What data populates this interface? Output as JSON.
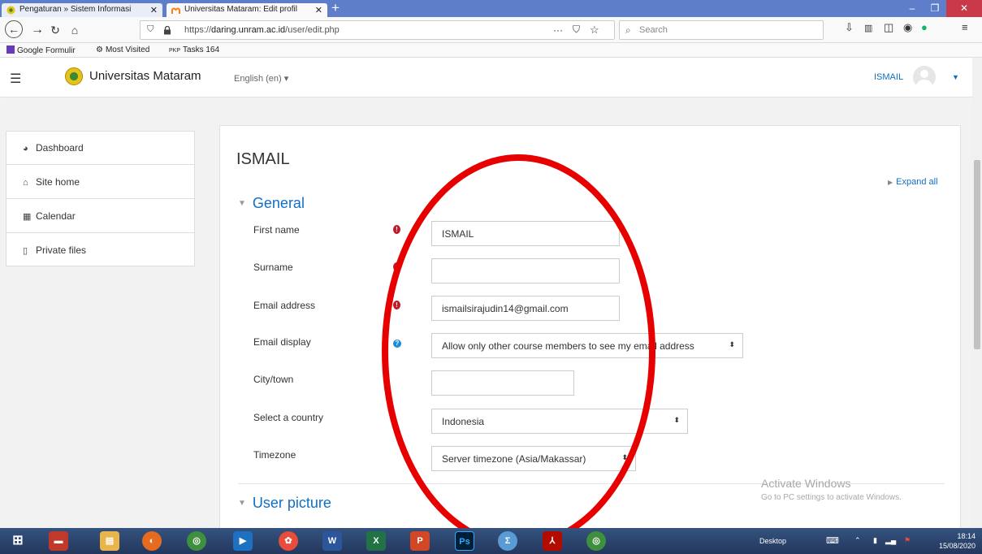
{
  "browser": {
    "tabs": [
      {
        "label": "Pengaturan » Sistem Informasi",
        "close": "✕"
      },
      {
        "label": "Universitas Mataram: Edit profil",
        "close": "✕"
      }
    ],
    "new_tab": "+",
    "url_prefix": "https://",
    "url_host": "daring.unram.ac.id",
    "url_path": "/user/edit.php",
    "url_more": "···",
    "search_placeholder": "Search"
  },
  "bookmarks": [
    {
      "label": "Google Formulir"
    },
    {
      "label": "Most Visited"
    },
    {
      "prefix": "PKP",
      "label": "Tasks 164"
    }
  ],
  "header": {
    "site_name": "Universitas Mataram",
    "language": "English (en) ▾",
    "user": "ISMAIL"
  },
  "sidebar": {
    "items": [
      {
        "label": "Dashboard",
        "icon": "dashboard-icon"
      },
      {
        "label": "Site home",
        "icon": "home-icon"
      },
      {
        "label": "Calendar",
        "icon": "calendar-icon"
      },
      {
        "label": "Private files",
        "icon": "file-icon"
      }
    ]
  },
  "content": {
    "heading": "ISMAIL",
    "expand_all": "Expand all",
    "section_general": "General",
    "section_picture": "User picture",
    "fields": {
      "first_name": {
        "label": "First name",
        "value": "ISMAIL"
      },
      "surname": {
        "label": "Surname",
        "value": ""
      },
      "email": {
        "label": "Email address",
        "value": "ismailsirajudin14@gmail.com"
      },
      "email_display": {
        "label": "Email display",
        "value": "Allow only other course members to see my email address"
      },
      "city": {
        "label": "City/town",
        "value": ""
      },
      "country": {
        "label": "Select a country",
        "value": "Indonesia"
      },
      "timezone": {
        "label": "Timezone",
        "value": "Server timezone (Asia/Makassar)"
      }
    }
  },
  "watermark": {
    "title": "Activate Windows",
    "subtitle": "Go to PC settings to activate Windows."
  },
  "taskbar": {
    "desktop_label": "Desktop",
    "time": "18:14",
    "date": "15/08/2020"
  },
  "colors": {
    "accent": "#0f6fc5",
    "required": "#c21a2b",
    "annotation": "#e60000"
  }
}
